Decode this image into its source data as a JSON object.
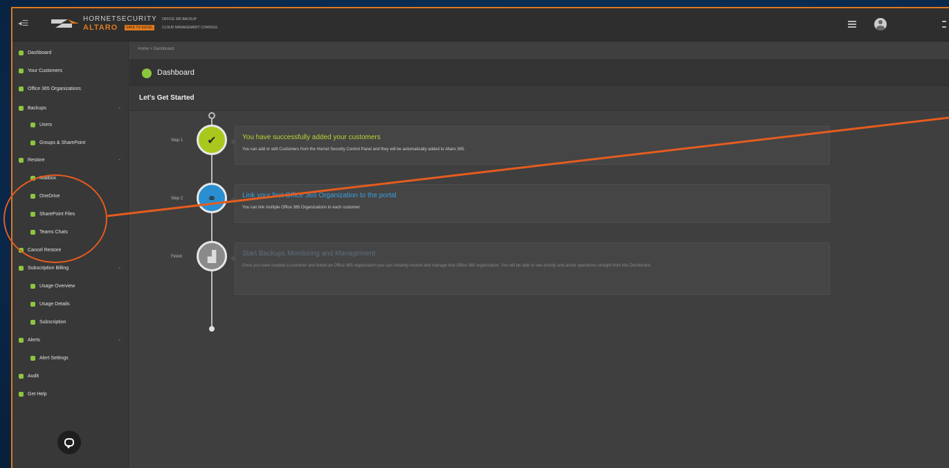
{
  "header": {
    "brand_primary": "HORNETSECURITY",
    "brand_secondary": "ALTARO",
    "brand_badge": "SAFE TO EXCEL",
    "product_line1": "OFFICE 365 BACKUP",
    "product_line2": "CLOUD MANAGEMENT CONSOLE"
  },
  "sidebar": {
    "items": [
      {
        "label": "Dashboard",
        "level": "top"
      },
      {
        "label": "Your Customers",
        "level": "top"
      },
      {
        "label": "Office 365 Organizations",
        "level": "top"
      },
      {
        "label": "Backups",
        "level": "top",
        "expand": "-"
      },
      {
        "label": "Users",
        "level": "sub"
      },
      {
        "label": "Groups & SharePoint",
        "level": "sub"
      },
      {
        "label": "Restore",
        "level": "top",
        "expand": "-"
      },
      {
        "label": "Mailbox",
        "level": "sub"
      },
      {
        "label": "OneDrive",
        "level": "sub"
      },
      {
        "label": "SharePoint Files",
        "level": "sub"
      },
      {
        "label": "Teams Chats",
        "level": "sub"
      },
      {
        "label": "Cancel Restore",
        "level": "top"
      },
      {
        "label": "Subscription Billing",
        "level": "top",
        "expand": "-"
      },
      {
        "label": "Usage Overview",
        "level": "sub"
      },
      {
        "label": "Usage Details",
        "level": "sub"
      },
      {
        "label": "Subscription",
        "level": "sub"
      },
      {
        "label": "Alerts",
        "level": "top",
        "expand": "-"
      },
      {
        "label": "Alert Settings",
        "level": "sub"
      },
      {
        "label": "Audit",
        "level": "top"
      },
      {
        "label": "Get Help",
        "level": "top"
      }
    ]
  },
  "main": {
    "breadcrumb": "Home > Dashboard",
    "title": "Dashboard",
    "section_title": "Let's Get Started",
    "steps": [
      {
        "label": "Step 1",
        "heading": "You have successfully added your customers",
        "text": "You can add or edit Customers from the Hornet Security Control Panel and they will be automatically added to Altaro 365.",
        "color": "#a8c81e",
        "heading_color": "#b9d434",
        "icon": "check-icon"
      },
      {
        "label": "Step 2",
        "heading": "Link your first Office 365 Organization to the portal",
        "text": "You can link multiple Office 365 Organizations to each customer.",
        "color": "#2a8fd0",
        "heading_color": "#3aa0e0",
        "icon": "link-icon"
      },
      {
        "label": "Finish",
        "heading": "Start Backups Monitoring and Management",
        "text": "Once you have created a customer and linked an Office 365 organization you can instantly restore and manage that Office 365 organization. You will be able to see activity and active operations straight from this Dashboard.",
        "color": "#8a8a8a",
        "heading_color": "#5f6f7f",
        "icon": "chart-icon"
      }
    ]
  },
  "colors": {
    "accent_orange": "#e07a1f",
    "annotation": "#e65c1e",
    "green": "#8cc63f"
  }
}
